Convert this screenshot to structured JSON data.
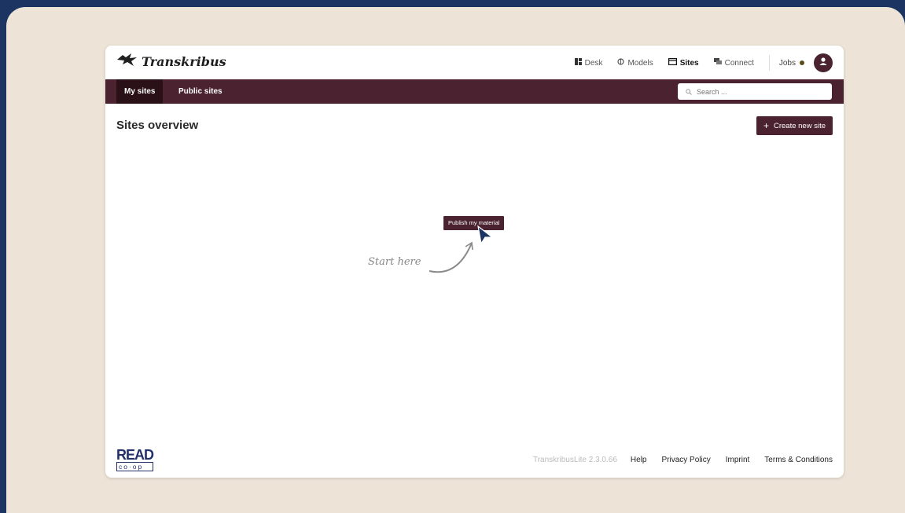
{
  "app": {
    "logo_text": "Transkribus"
  },
  "nav": {
    "desk": "Desk",
    "models": "Models",
    "sites": "Sites",
    "connect": "Connect",
    "jobs": "Jobs"
  },
  "subnav": {
    "my_sites": "My sites",
    "public_sites": "Public sites",
    "search_placeholder": "Search ..."
  },
  "main": {
    "title": "Sites overview",
    "create_button": "Create new site",
    "create_icon": "+",
    "publish_button": "Publish my material",
    "hint": "Start here"
  },
  "footer": {
    "read_logo": "READ",
    "read_sub": "co·op",
    "version": "TranskribusLite 2.3.0.66",
    "help": "Help",
    "privacy": "Privacy Policy",
    "imprint": "Imprint",
    "terms": "Terms & Conditions"
  },
  "colors": {
    "background": "#1b3461",
    "canvas": "#ede4d7",
    "brand": "#4b2330"
  }
}
